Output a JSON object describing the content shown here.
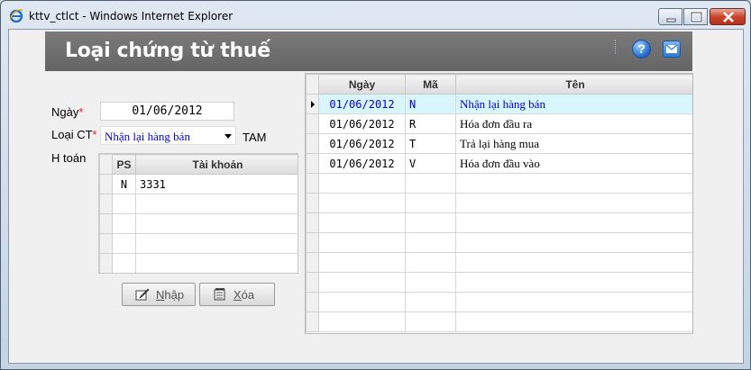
{
  "window": {
    "title": "kttv_ctlct - Windows Internet Explorer"
  },
  "header": {
    "title": "Loại chứng từ thuế",
    "help_label": "?"
  },
  "form": {
    "date_label": "Ngày",
    "date_value": "01/06/2012",
    "type_label": "Loại CT",
    "required_mark": "*",
    "type_value": "Nhận lại hàng bán",
    "type_suffix": "TAM",
    "account_label": "H toán"
  },
  "accounts_grid": {
    "columns": [
      "PS",
      "Tài khoản"
    ],
    "rows": [
      [
        "N",
        "3331"
      ],
      [
        "",
        ""
      ],
      [
        "",
        ""
      ],
      [
        "",
        ""
      ],
      [
        "",
        ""
      ]
    ]
  },
  "buttons": {
    "save_label": "Nhập",
    "save_hotkey": "N",
    "save_rest": "hập",
    "delete_label": "Xóa",
    "delete_hotkey": "X",
    "delete_rest": "óa"
  },
  "main_grid": {
    "columns": [
      "Ngày",
      "Mã",
      "Tên"
    ],
    "selected_row": 0,
    "rows": [
      [
        "01/06/2012",
        "N",
        "Nhận lại hàng bán"
      ],
      [
        "01/06/2012",
        "R",
        "Hóa đơn đầu ra"
      ],
      [
        "01/06/2012",
        "T",
        "Trả lại hàng mua"
      ],
      [
        "01/06/2012",
        "V",
        "Hóa đơn đầu vào"
      ],
      [
        "",
        "",
        ""
      ],
      [
        "",
        "",
        ""
      ],
      [
        "",
        "",
        ""
      ],
      [
        "",
        "",
        ""
      ],
      [
        "",
        "",
        ""
      ],
      [
        "",
        "",
        ""
      ],
      [
        "",
        "",
        ""
      ],
      [
        "",
        "",
        ""
      ]
    ]
  },
  "colors": {
    "banner": "#6f6f6f",
    "selected_row": "#d8f6fb",
    "link_blue": "#0000e0",
    "required_red": "#e02020"
  }
}
